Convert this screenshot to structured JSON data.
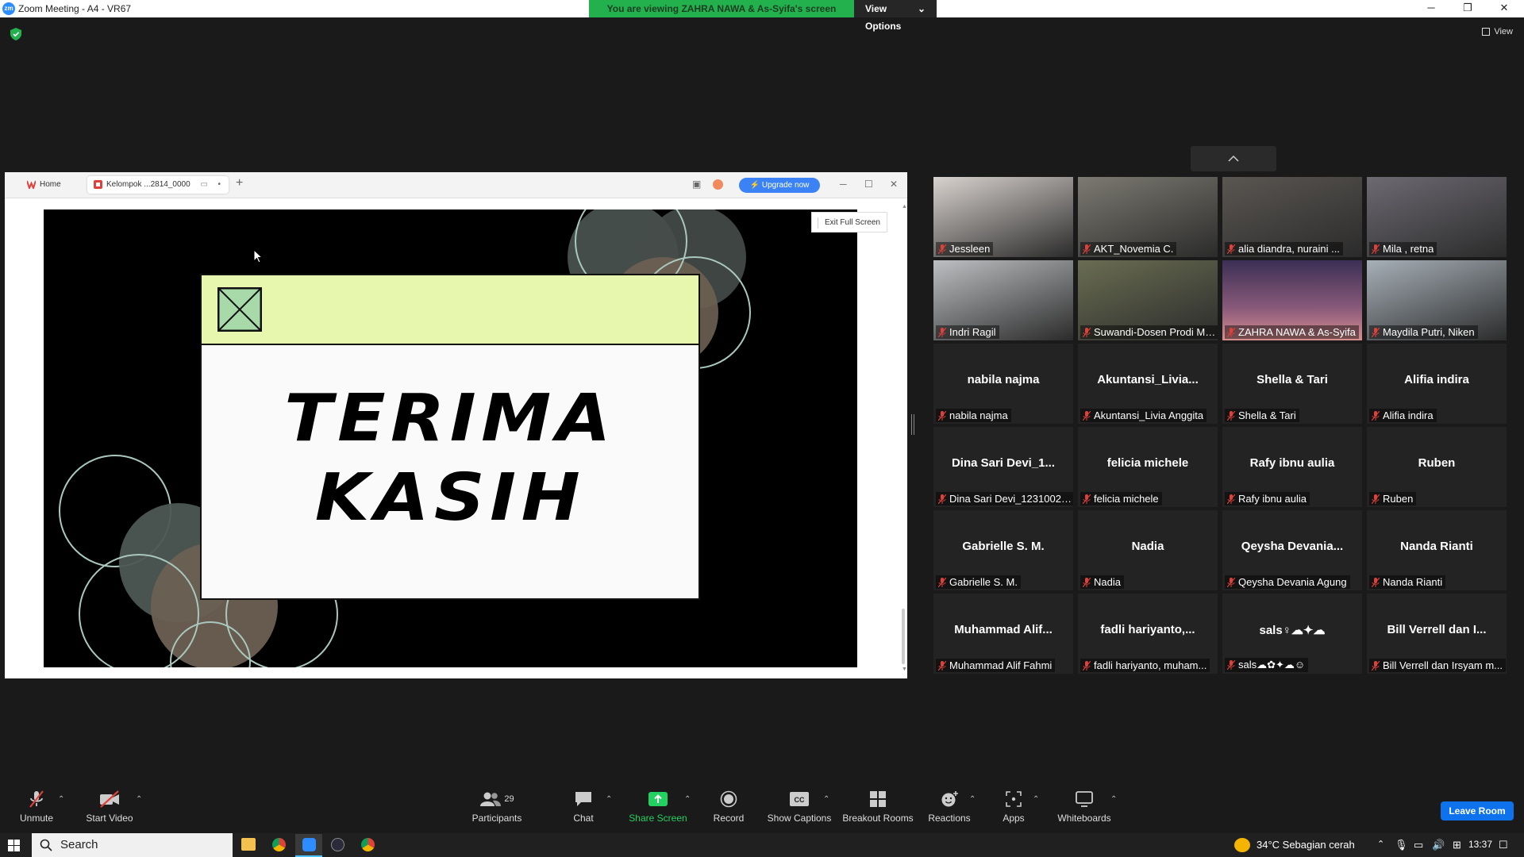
{
  "window": {
    "title": "Zoom Meeting - A4 - VR67",
    "logo_text": "zm",
    "controls": [
      "minimize-icon",
      "restore-icon",
      "close-icon"
    ]
  },
  "banner": {
    "message": "You are viewing ZAHRA NAWA & As-Syifa's screen",
    "view_options": "View Options",
    "accent": "#23b14d"
  },
  "top": {
    "view_label": "View"
  },
  "shared_screen": {
    "browser": {
      "home_tab": "Home",
      "doc_tab": "Kelompok ...2814_0000",
      "upgrade": "Upgrade now"
    },
    "exit_full_screen": "Exit Full Screen",
    "slide": {
      "line1": "TERIMA",
      "line2": "KASIH",
      "header_color": "#e7f7ae"
    }
  },
  "participants": [
    {
      "label": "Jessleen",
      "video": true
    },
    {
      "label": "AKT_Novemia C.",
      "video": true
    },
    {
      "label": "alia diandra, nuraini ...",
      "video": true
    },
    {
      "label": "Mila , retna",
      "video": true
    },
    {
      "label": "Indri Ragil",
      "video": true
    },
    {
      "label": "Suwandi-Dosen Prodi Man...",
      "video": true
    },
    {
      "label": "ZAHRA NAWA & As-Syifa",
      "video": true,
      "active": true
    },
    {
      "label": "Maydila Putri, Niken",
      "video": true
    },
    {
      "name": "nabila najma",
      "label": "nabila najma"
    },
    {
      "name": "Akuntansi_Livia...",
      "label": "Akuntansi_Livia Anggita"
    },
    {
      "name": "Shella & Tari",
      "label": "Shella & Tari"
    },
    {
      "name": "Alifia indira",
      "label": "Alifia indira"
    },
    {
      "name": "Dina Sari Devi_1...",
      "label": "Dina Sari Devi_12310020..."
    },
    {
      "name": "felicia michele",
      "label": "felicia michele"
    },
    {
      "name": "Rafy ibnu aulia",
      "label": "Rafy ibnu aulia"
    },
    {
      "name": "Ruben",
      "label": "Ruben"
    },
    {
      "name": "Gabrielle S. M.",
      "label": "Gabrielle S. M."
    },
    {
      "name": "Nadia",
      "label": "Nadia"
    },
    {
      "name": "Qeysha Devania...",
      "label": "Qeysha Devania Agung"
    },
    {
      "name": "Nanda Rianti",
      "label": "Nanda Rianti"
    },
    {
      "name": "Muhammad Alif...",
      "label": "Muhammad Alif Fahmi"
    },
    {
      "name": "fadli hariyanto,...",
      "label": "fadli hariyanto, muham..."
    },
    {
      "name": "sals♀☁✦☁",
      "label": "sals☁✿✦☁☺"
    },
    {
      "name": "Bill Verrell dan I...",
      "label": "Bill Verrell dan Irsyam m..."
    }
  ],
  "toolbar": {
    "unmute": "Unmute",
    "start_video": "Start Video",
    "participants": "Participants",
    "participants_count": "29",
    "chat": "Chat",
    "share_screen": "Share Screen",
    "record": "Record",
    "show_captions": "Show Captions",
    "breakout_rooms": "Breakout Rooms",
    "reactions": "Reactions",
    "apps": "Apps",
    "whiteboards": "Whiteboards",
    "leave": "Leave Room"
  },
  "taskbar": {
    "search": "Search",
    "weather": "34°C  Sebagian cerah",
    "time": "13:37"
  }
}
